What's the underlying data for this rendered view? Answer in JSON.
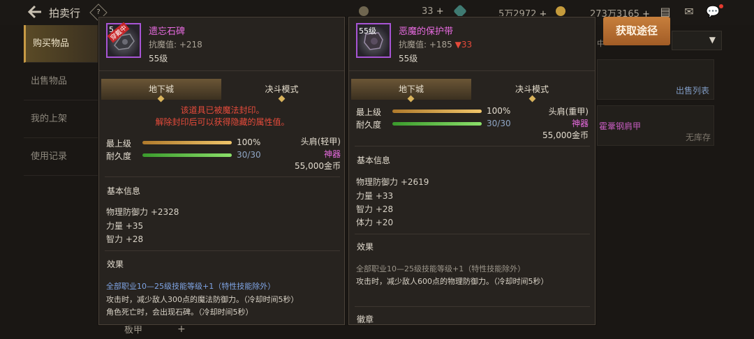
{
  "header": {
    "title": "拍卖行",
    "help": "?",
    "currencies": [
      {
        "value": "33",
        "plus": "+"
      },
      {
        "value": "5万2972",
        "plus": "+"
      },
      {
        "value": "273万3165",
        "plus": "+"
      }
    ]
  },
  "sidebar": {
    "items": [
      {
        "label": "购买物品"
      },
      {
        "label": "出售物品"
      },
      {
        "label": "我的上架"
      },
      {
        "label": "使用记录"
      }
    ]
  },
  "background": {
    "sell_list": "出售列表",
    "peek_item": "霍鞷钢肩甲",
    "no_stock": "无库存",
    "dropdown_prefix": "中",
    "bottom_label": "板甲",
    "bottom_plus": "+"
  },
  "get_path_button": "获取途径",
  "card_a": {
    "level_badge": "5",
    "stamp": "穿戴中",
    "name": "遗忘石碑",
    "anti_magic": "抗魔值: +218",
    "level": "55级",
    "tabs": [
      "地下城",
      "决斗模式"
    ],
    "sealed_line1": "该道具已被魔法封印。",
    "sealed_line2": "解除封印后可以获得隐藏的属性值。",
    "stats": [
      {
        "label": "最上级",
        "value": "100%",
        "fill": 100
      },
      {
        "label": "耐久度",
        "value": "30/30",
        "fill": 100
      }
    ],
    "slot": "头肩(轻甲)",
    "rarity": "神器",
    "price": "55,000金币",
    "basic_title": "基本信息",
    "attrs": [
      "物理防御力 +2328",
      "力量 +35",
      "智力 +28"
    ],
    "effect_title": "效果",
    "effects": [
      "全部职业10—25级技能等级+1（特性技能除外）",
      "攻击时，减少敌人300点的魔法防御力。（冷却时间5秒）",
      "角色死亡时，会出现石碑。（冷却时间5秒）"
    ]
  },
  "card_b": {
    "level_badge": "55级",
    "name": "恶魔的保护带",
    "anti_magic": "抗魔值: +185",
    "anti_diff": "▼33",
    "level": "55级",
    "tabs": [
      "地下城",
      "决斗模式"
    ],
    "stats": [
      {
        "label": "最上级",
        "value": "100%",
        "fill": 100
      },
      {
        "label": "耐久度",
        "value": "30/30",
        "fill": 100
      }
    ],
    "slot": "头肩(重甲)",
    "rarity": "神器",
    "price": "55,000金币",
    "basic_title": "基本信息",
    "attrs": [
      "物理防御力 +2619",
      "力量 +33",
      "智力 +28",
      "体力 +20"
    ],
    "effect_title": "效果",
    "effects": [
      "全部职业10—25级技能等级+1（特性技能除外）",
      "攻击时，减少敌人600点的物理防御力。（冷却时间5秒）"
    ],
    "cutoff_title": "徽章"
  },
  "colors": {
    "accent_orange": "#b8692f",
    "epic_purple": "#e86be0",
    "sealed_red": "#e64b3b",
    "skill_blue": "#7fa4e4"
  }
}
